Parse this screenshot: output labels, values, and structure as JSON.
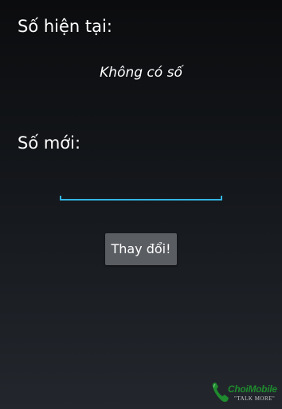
{
  "labels": {
    "current_number": "Số hiện tại:",
    "new_number": "Số mới:"
  },
  "current_value": "Không có số",
  "new_number_input": {
    "value": "",
    "placeholder": ""
  },
  "change_button_label": "Thay đổi!",
  "watermark": {
    "brand": "ChoiMobile",
    "tagline": "\"TALK MORE\""
  },
  "colors": {
    "accent": "#33b5e5",
    "button": "#5a5d62",
    "watermark_green": "#1f8a2e"
  }
}
